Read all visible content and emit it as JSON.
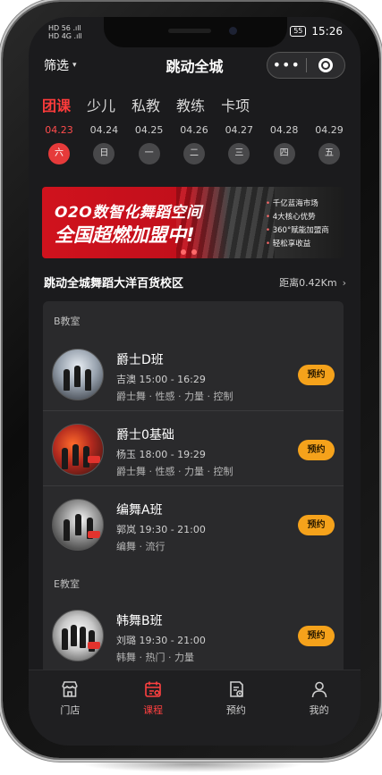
{
  "status_bar": {
    "left_line1": "HD 56 .ıll",
    "left_line2": "HD 4G .ıll",
    "battery": "55",
    "time": "15:26"
  },
  "navbar": {
    "filter_label": "筛选",
    "title": "跳动全城",
    "more_label": "•••"
  },
  "tabs": [
    {
      "label": "团课",
      "active": true
    },
    {
      "label": "少儿",
      "active": false
    },
    {
      "label": "私教",
      "active": false
    },
    {
      "label": "教练",
      "active": false
    },
    {
      "label": "卡项",
      "active": false
    }
  ],
  "dates": [
    {
      "date": "04.23",
      "weekday": "六",
      "active": true
    },
    {
      "date": "04.24",
      "weekday": "日",
      "active": false
    },
    {
      "date": "04.25",
      "weekday": "一",
      "active": false
    },
    {
      "date": "04.26",
      "weekday": "二",
      "active": false
    },
    {
      "date": "04.27",
      "weekday": "三",
      "active": false
    },
    {
      "date": "04.28",
      "weekday": "四",
      "active": false
    },
    {
      "date": "04.29",
      "weekday": "五",
      "active": false
    }
  ],
  "banner": {
    "line1": "O2O数智化舞蹈空间",
    "line2": "全国超燃加盟中!",
    "bullets": [
      "千亿蓝海市场",
      "4大核心优势",
      "360°赋能加盟商",
      "轻松享收益"
    ]
  },
  "store": {
    "name": "跳动全城舞蹈大洋百货校区",
    "distance": "距离0.42Km"
  },
  "rooms": [
    {
      "name": "B教室",
      "courses": [
        {
          "title": "爵士D班",
          "info": "吉澳   15:00 - 16:29",
          "tags": "爵士舞 · 性感 · 力量 · 控制",
          "button": "预约"
        },
        {
          "title": "爵士0基础",
          "info": "杨玉   18:00 - 19:29",
          "tags": "爵士舞 · 性感 · 力量 · 控制",
          "button": "预约"
        },
        {
          "title": "编舞A班",
          "info": "郭岚   19:30 - 21:00",
          "tags": "编舞 · 流行",
          "button": "预约"
        }
      ]
    },
    {
      "name": "E教室",
      "courses": [
        {
          "title": "韩舞B班",
          "info": "刘璐   19:30 - 21:00",
          "tags": "韩舞 · 热门 · 力量",
          "button": "预约"
        }
      ]
    }
  ],
  "tabbar": [
    {
      "label": "门店",
      "icon": "store-icon",
      "active": false
    },
    {
      "label": "课程",
      "icon": "calendar-icon",
      "active": true
    },
    {
      "label": "预约",
      "icon": "booking-icon",
      "active": false
    },
    {
      "label": "我的",
      "icon": "profile-icon",
      "active": false
    }
  ],
  "colors": {
    "accent": "#ff3b3b",
    "button": "#f5a21b",
    "background": "#1b1b1d",
    "panel": "#2a2a2c"
  }
}
